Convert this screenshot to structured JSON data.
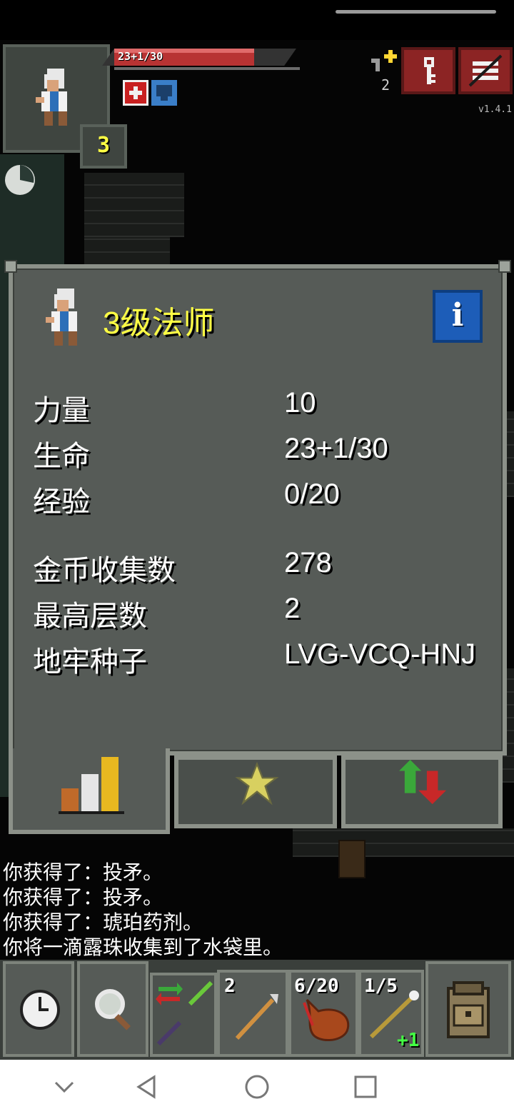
{
  "hud": {
    "hp_text": "23+1/30",
    "hp_fraction": 0.77,
    "hero_level": "3",
    "level_up_count": "2",
    "version": "v1.4.1"
  },
  "window": {
    "title": "3级法师",
    "info_glyph": "i",
    "stats": [
      {
        "label": "力量",
        "value": "10"
      },
      {
        "label": "生命",
        "value": "23+1/30"
      },
      {
        "label": "经验",
        "value": "0/20"
      }
    ],
    "records": [
      {
        "label": "金币收集数",
        "value": "278"
      },
      {
        "label": "最高层数",
        "value": "2"
      },
      {
        "label": "地牢种子",
        "value": "LVG-VCQ-HNJ"
      }
    ]
  },
  "log": [
    "你获得了：投矛。",
    "你获得了：投矛。",
    "你获得了：琥珀药剂。",
    "你将一滴露珠收集到了水袋里。"
  ],
  "quickslots": {
    "slot1": "2",
    "slot2": "6/20",
    "slot3": "1/5",
    "slot3_upgrade": "+1"
  },
  "colors": {
    "title_yellow": "#ffff44",
    "window_bg": "#565b57",
    "menu_red": "#8c2424",
    "info_blue": "#1d5db8"
  }
}
